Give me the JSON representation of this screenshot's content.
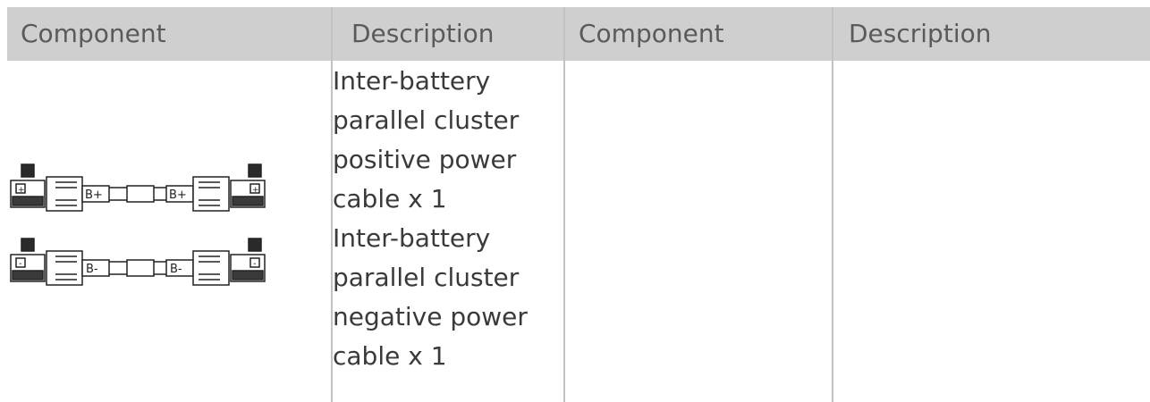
{
  "table": {
    "headers": [
      "Component",
      "Description",
      "Component",
      "Description"
    ],
    "rows": [
      {
        "component_image": "battery-parallel-cables-icon",
        "cables": [
          {
            "label_left": "B+",
            "label_right": "B+",
            "end_mark": "+"
          },
          {
            "label_left": "B-",
            "label_right": "B-",
            "end_mark": "-"
          }
        ],
        "description_lines": [
          "Inter-battery",
          "parallel cluster",
          "positive power",
          "cable x 1",
          "Inter-battery",
          "parallel cluster",
          "negative power",
          "cable x 1"
        ]
      }
    ]
  },
  "colors": {
    "header_bg": "#cfcfcf",
    "header_text": "#5a5a5a",
    "body_text": "#3a3a3a",
    "grid": "#c2c2c2"
  }
}
